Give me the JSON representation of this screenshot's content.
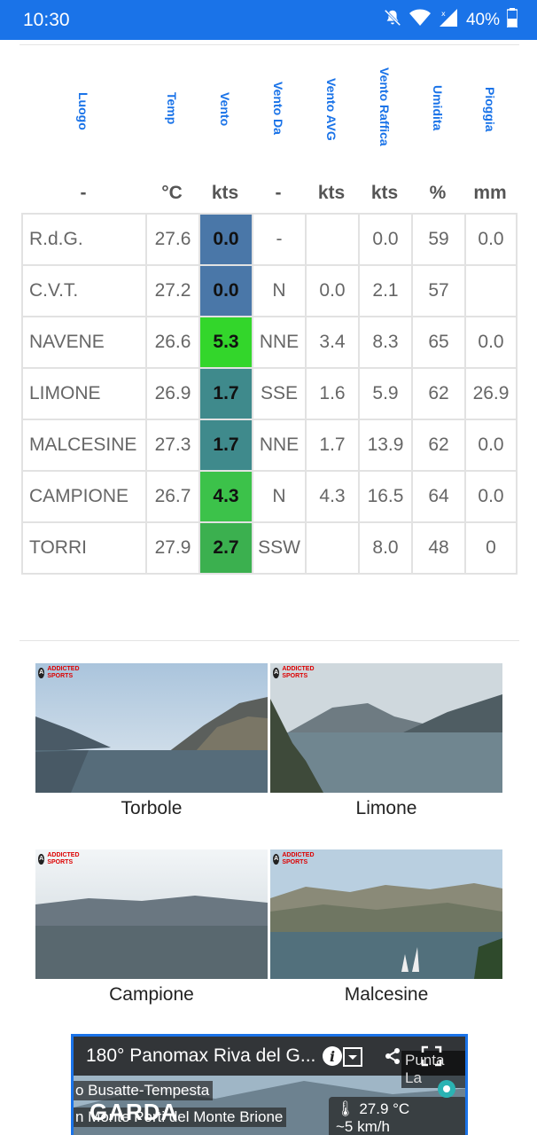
{
  "status_bar": {
    "time": "10:30",
    "battery": "40%"
  },
  "table": {
    "headers": [
      "Luogo",
      "Temp",
      "Vento",
      "Vento Da",
      "Vento AVG",
      "Vento Raffica",
      "Umidita",
      "Pioggia"
    ],
    "units": [
      "-",
      "°C",
      "kts",
      "-",
      "kts",
      "kts",
      "%",
      "mm"
    ],
    "rows": [
      {
        "luogo": "R.d.G.",
        "temp": "27.6",
        "vento": "0.0",
        "da": "-",
        "avg": "",
        "raffica": "0.0",
        "umidita": "59",
        "pioggia": "0.0",
        "vento_color": "#4a77a8"
      },
      {
        "luogo": "C.V.T.",
        "temp": "27.2",
        "vento": "0.0",
        "da": "N",
        "avg": "0.0",
        "raffica": "2.1",
        "umidita": "57",
        "pioggia": "",
        "vento_color": "#4a77a8"
      },
      {
        "luogo": "NAVENE",
        "temp": "26.6",
        "vento": "5.3",
        "da": "NNE",
        "avg": "3.4",
        "raffica": "8.3",
        "umidita": "65",
        "pioggia": "0.0",
        "vento_color": "#33d62b"
      },
      {
        "luogo": "LIMONE",
        "temp": "26.9",
        "vento": "1.7",
        "da": "SSE",
        "avg": "1.6",
        "raffica": "5.9",
        "umidita": "62",
        "pioggia": "26.9",
        "vento_color": "#3f8a8c"
      },
      {
        "luogo": "MALCESINE",
        "temp": "27.3",
        "vento": "1.7",
        "da": "NNE",
        "avg": "1.7",
        "raffica": "13.9",
        "umidita": "62",
        "pioggia": "0.0",
        "vento_color": "#3f8a8c"
      },
      {
        "luogo": "CAMPIONE",
        "temp": "26.7",
        "vento": "4.3",
        "da": "N",
        "avg": "4.3",
        "raffica": "16.5",
        "umidita": "64",
        "pioggia": "0.0",
        "vento_color": "#3cc24a"
      },
      {
        "luogo": "TORRI",
        "temp": "27.9",
        "vento": "2.7",
        "da": "SSW",
        "avg": "",
        "raffica": "8.0",
        "umidita": "48",
        "pioggia": "0",
        "vento_color": "#3bb04f"
      }
    ]
  },
  "webcams": [
    {
      "label": "Torbole",
      "logo": "ADDICTED SPORTS"
    },
    {
      "label": "Limone",
      "logo": "ADDICTED SPORTS"
    },
    {
      "label": "Campione",
      "logo": "ADDICTED SPORTS"
    },
    {
      "label": "Malcesine",
      "logo": "ADDICTED SPORTS"
    }
  ],
  "panorama": {
    "title": "180° Panomax Riva del G...",
    "overlay_1": "o Busatte-Tempesta",
    "overlay_2": "n Monte Porti del Monte Brione",
    "brand": "GARDA",
    "temperature": "27.9 °C",
    "wind": "~5 km/h",
    "location_tag": "Punta La"
  }
}
